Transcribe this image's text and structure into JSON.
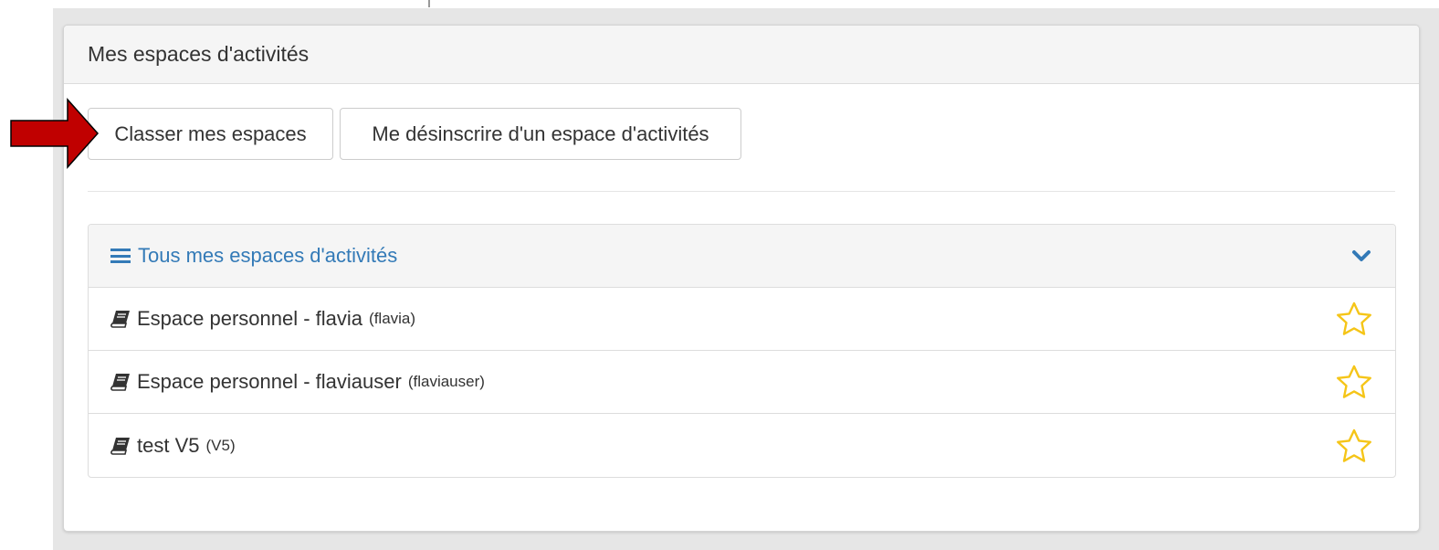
{
  "panel": {
    "title": "Mes espaces d'activités"
  },
  "buttons": {
    "sort_label": "Classer mes espaces",
    "unsubscribe_label": "Me désinscrire d'un espace d'activités"
  },
  "list": {
    "header": "Tous mes espaces d'activités",
    "items": [
      {
        "name": "Espace personnel - flavia",
        "code": "(flavia)"
      },
      {
        "name": "Espace personnel - flaviauser",
        "code": "(flaviauser)"
      },
      {
        "name": "test V5",
        "code": "(V5)"
      }
    ]
  },
  "colors": {
    "link_blue": "#337ab7",
    "star_gold": "#f5c518",
    "arrow_red": "#c00000"
  },
  "icons": {
    "list_header": "list-icon",
    "collapse": "chevron-down-icon",
    "item": "book-icon",
    "favorite": "star-outline-icon",
    "annotation": "red-arrow-icon"
  }
}
